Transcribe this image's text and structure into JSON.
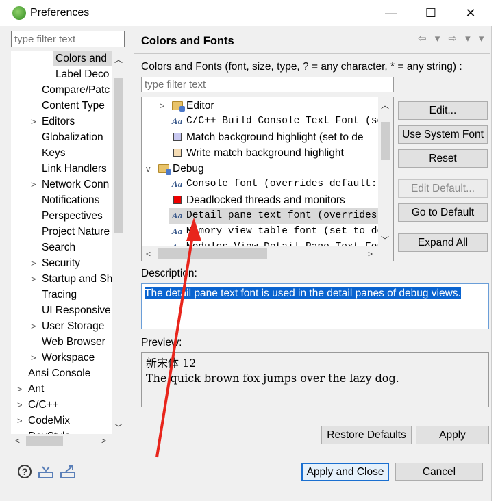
{
  "window": {
    "title": "Preferences",
    "minimize": "—",
    "maximize": "☐",
    "close": "✕"
  },
  "left": {
    "filter_placeholder": "type filter text",
    "items": [
      {
        "label": "Colors and",
        "indent": 3,
        "twisty": ""
      },
      {
        "label": "Label Deco",
        "indent": 3,
        "twisty": ""
      },
      {
        "label": "Compare/Patc",
        "indent": 2,
        "twisty": ""
      },
      {
        "label": "Content Type",
        "indent": 2,
        "twisty": ""
      },
      {
        "label": "Editors",
        "indent": 2,
        "twisty": ">"
      },
      {
        "label": "Globalization",
        "indent": 2,
        "twisty": ""
      },
      {
        "label": "Keys",
        "indent": 2,
        "twisty": ""
      },
      {
        "label": "Link Handlers",
        "indent": 2,
        "twisty": ""
      },
      {
        "label": "Network Conn",
        "indent": 2,
        "twisty": ">"
      },
      {
        "label": "Notifications",
        "indent": 2,
        "twisty": ""
      },
      {
        "label": "Perspectives",
        "indent": 2,
        "twisty": ""
      },
      {
        "label": "Project Nature",
        "indent": 2,
        "twisty": ""
      },
      {
        "label": "Search",
        "indent": 2,
        "twisty": ""
      },
      {
        "label": "Security",
        "indent": 2,
        "twisty": ">"
      },
      {
        "label": "Startup and Sh",
        "indent": 2,
        "twisty": ">"
      },
      {
        "label": "Tracing",
        "indent": 2,
        "twisty": ""
      },
      {
        "label": "UI Responsive",
        "indent": 2,
        "twisty": ""
      },
      {
        "label": "User Storage",
        "indent": 2,
        "twisty": ">"
      },
      {
        "label": "Web Browser",
        "indent": 2,
        "twisty": ""
      },
      {
        "label": "Workspace",
        "indent": 2,
        "twisty": ">"
      },
      {
        "label": "Ansi Console",
        "indent": 1,
        "twisty": ""
      },
      {
        "label": "Ant",
        "indent": 1,
        "twisty": ">"
      },
      {
        "label": "C/C++",
        "indent": 1,
        "twisty": ">"
      },
      {
        "label": "CodeMix",
        "indent": 1,
        "twisty": ">"
      },
      {
        "label": "DevStyle",
        "indent": 1,
        "twisty": ">"
      }
    ]
  },
  "right": {
    "title": "Colors and Fonts",
    "nav": "⇦ ▾ ⇨ ▾ ▾",
    "description_line": "Colors and Fonts (font, size, type, ? = any character, * = any string) :",
    "filter_placeholder": "type filter text",
    "tree": [
      {
        "kind": "category",
        "twisty": ">",
        "label": "Editor",
        "indent": 1
      },
      {
        "kind": "font",
        "label": "C/C++ Build Console Text Font (set",
        "indent": 2
      },
      {
        "kind": "color",
        "color": "#c8c8f0",
        "label": "Match background highlight (set to de",
        "indent": 2
      },
      {
        "kind": "color",
        "color": "#f5dcb4",
        "label": "Write match background highlight",
        "indent": 2
      },
      {
        "kind": "category",
        "twisty": "v",
        "label": "Debug",
        "indent": 0
      },
      {
        "kind": "font",
        "label": "Console font (overrides default: Te",
        "indent": 2
      },
      {
        "kind": "color",
        "color": "#ee0000",
        "label": "Deadlocked threads and monitors",
        "indent": 2
      },
      {
        "kind": "font",
        "label": "Detail pane text font (overrides de",
        "indent": 2,
        "selected": true
      },
      {
        "kind": "font",
        "label": "Memory view table font (set to defa",
        "indent": 2
      },
      {
        "kind": "font",
        "label": "Modules View Detail Pane Text Font",
        "indent": 2
      }
    ],
    "buttons": {
      "edit": "Edit...",
      "use_system_font": "Use System Font",
      "reset": "Reset",
      "edit_default": "Edit Default...",
      "go_to_default": "Go to Default",
      "expand_all": "Expand All"
    },
    "description_label": "Description:",
    "description_text": "The detail pane text font is used in the detail panes of debug views.",
    "preview_label": "Preview:",
    "preview_line1": "新宋体 12",
    "preview_line2": "The quick brown fox jumps over the lazy dog.",
    "restore_defaults": "Restore Defaults",
    "apply": "Apply"
  },
  "footer": {
    "help_glyph": "?",
    "apply_and_close": "Apply and Close",
    "cancel": "Cancel"
  },
  "colors": {
    "selection": "#0a64d0",
    "annotation_arrow": "#e8251c"
  }
}
